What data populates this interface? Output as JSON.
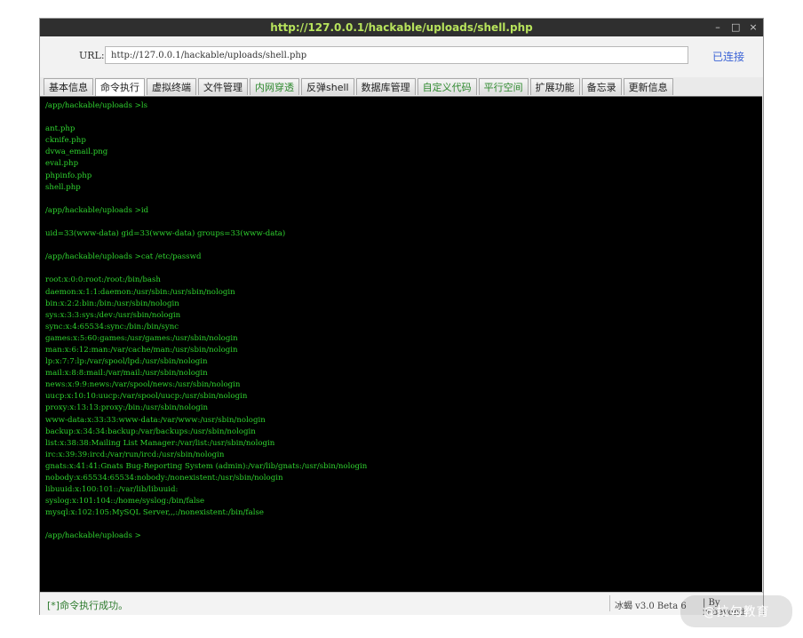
{
  "window": {
    "title": "http://127.0.0.1/hackable/uploads/shell.php",
    "controls": {
      "minimize": "–",
      "maximize": "□",
      "close": "×"
    }
  },
  "url_bar": {
    "label": "URL:",
    "value": "http://127.0.0.1/hackable/uploads/shell.php",
    "status": "已连接"
  },
  "tabs": [
    "基本信息",
    "命令执行",
    "虚拟终端",
    "文件管理",
    "内网穿透",
    "反弹shell",
    "数据库管理",
    "自定义代码",
    "平行空间",
    "扩展功能",
    "备忘录",
    "更新信息"
  ],
  "active_tab": "命令执行",
  "terminal": {
    "lines": [
      "/app/hackable/uploads >ls",
      "",
      "ant.php",
      "cknife.php",
      "dvwa_email.png",
      "eval.php",
      "phpinfo.php",
      "shell.php",
      "",
      "/app/hackable/uploads >id",
      "",
      "uid=33(www-data) gid=33(www-data) groups=33(www-data)",
      "",
      "/app/hackable/uploads >cat /etc/passwd",
      "",
      "root:x:0:0:root:/root:/bin/bash",
      "daemon:x:1:1:daemon:/usr/sbin:/usr/sbin/nologin",
      "bin:x:2:2:bin:/bin:/usr/sbin/nologin",
      "sys:x:3:3:sys:/dev:/usr/sbin/nologin",
      "sync:x:4:65534:sync:/bin:/bin/sync",
      "games:x:5:60:games:/usr/games:/usr/sbin/nologin",
      "man:x:6:12:man:/var/cache/man:/usr/sbin/nologin",
      "lp:x:7:7:lp:/var/spool/lpd:/usr/sbin/nologin",
      "mail:x:8:8:mail:/var/mail:/usr/sbin/nologin",
      "news:x:9:9:news:/var/spool/news:/usr/sbin/nologin",
      "uucp:x:10:10:uucp:/var/spool/uucp:/usr/sbin/nologin",
      "proxy:x:13:13:proxy:/bin:/usr/sbin/nologin",
      "www-data:x:33:33:www-data:/var/www:/usr/sbin/nologin",
      "backup:x:34:34:backup:/var/backups:/usr/sbin/nologin",
      "list:x:38:38:Mailing List Manager:/var/list:/usr/sbin/nologin",
      "irc:x:39:39:ircd:/var/run/ircd:/usr/sbin/nologin",
      "gnats:x:41:41:Gnats Bug-Reporting System (admin):/var/lib/gnats:/usr/sbin/nologin",
      "nobody:x:65534:65534:nobody:/nonexistent:/usr/sbin/nologin",
      "libuuid:x:100:101::/var/lib/libuuid:",
      "syslog:x:101:104::/home/syslog:/bin/false",
      "mysql:x:102:105:MySQL Server,,,:/nonexistent:/bin/false",
      "",
      "/app/hackable/uploads >"
    ]
  },
  "status_bar": {
    "message": "[*]命令执行成功。",
    "version": "冰蝎 v3.0 Beta 6",
    "author": "| By rebeyond"
  },
  "watermark": "@拉勾教育"
}
